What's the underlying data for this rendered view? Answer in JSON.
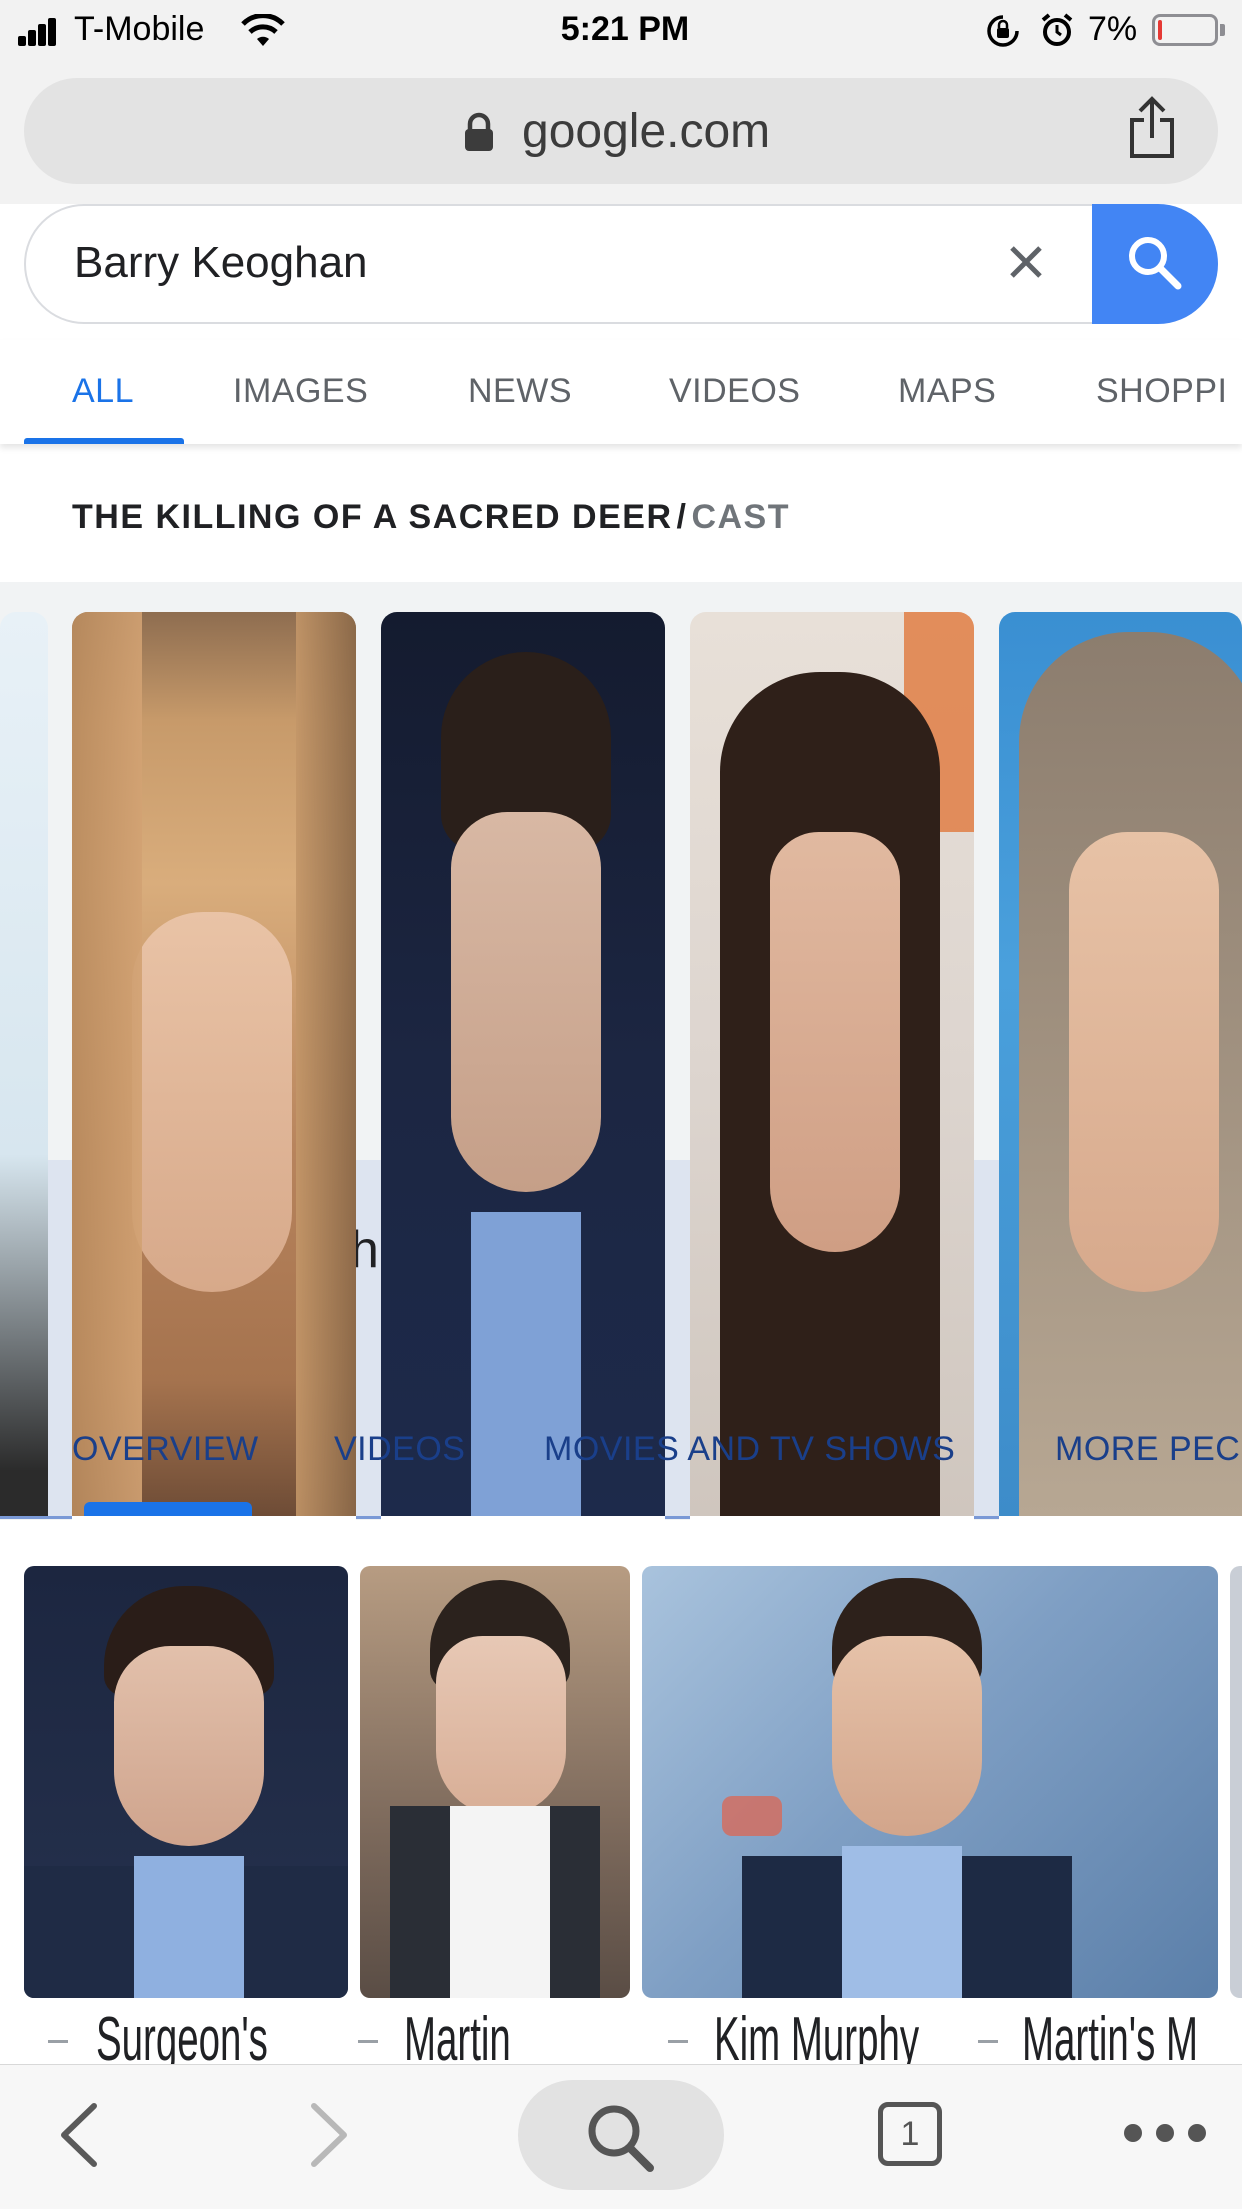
{
  "status_bar": {
    "carrier": "T-Mobile",
    "time": "5:21 PM",
    "battery": "7%",
    "battery_level": 0.07,
    "battery_color": "#e53935"
  },
  "address_bar": {
    "url": "google.com",
    "lock_icon": "lock-icon",
    "share_icon": "share-icon"
  },
  "search": {
    "query": "Barry Keoghan",
    "clear_icon": "close-icon",
    "search_icon": "search-icon",
    "accent": "#4285f4"
  },
  "tabs": [
    "ALL",
    "IMAGES",
    "NEWS",
    "VIDEOS",
    "MAPS",
    "SHOPPI"
  ],
  "active_tab": "ALL",
  "cast_section": {
    "title": "THE KILLING OF A SACRED DEER",
    "separator": "/",
    "subtitle": "CAST",
    "overlay_letter": "h",
    "sub_tabs": [
      "OVERVIEW",
      "VIDEOS",
      "MOVIES AND TV SHOWS",
      "MORE PEC"
    ]
  },
  "photo_captions": [
    "Surgeon's",
    "Martin",
    "Kim Murphy",
    "Martin's M"
  ],
  "toolbar": {
    "back_icon": "chevron-left-icon",
    "forward_icon": "chevron-right-icon",
    "search_icon": "search-icon",
    "tab_count": "1",
    "more_icon": "more-icon"
  }
}
